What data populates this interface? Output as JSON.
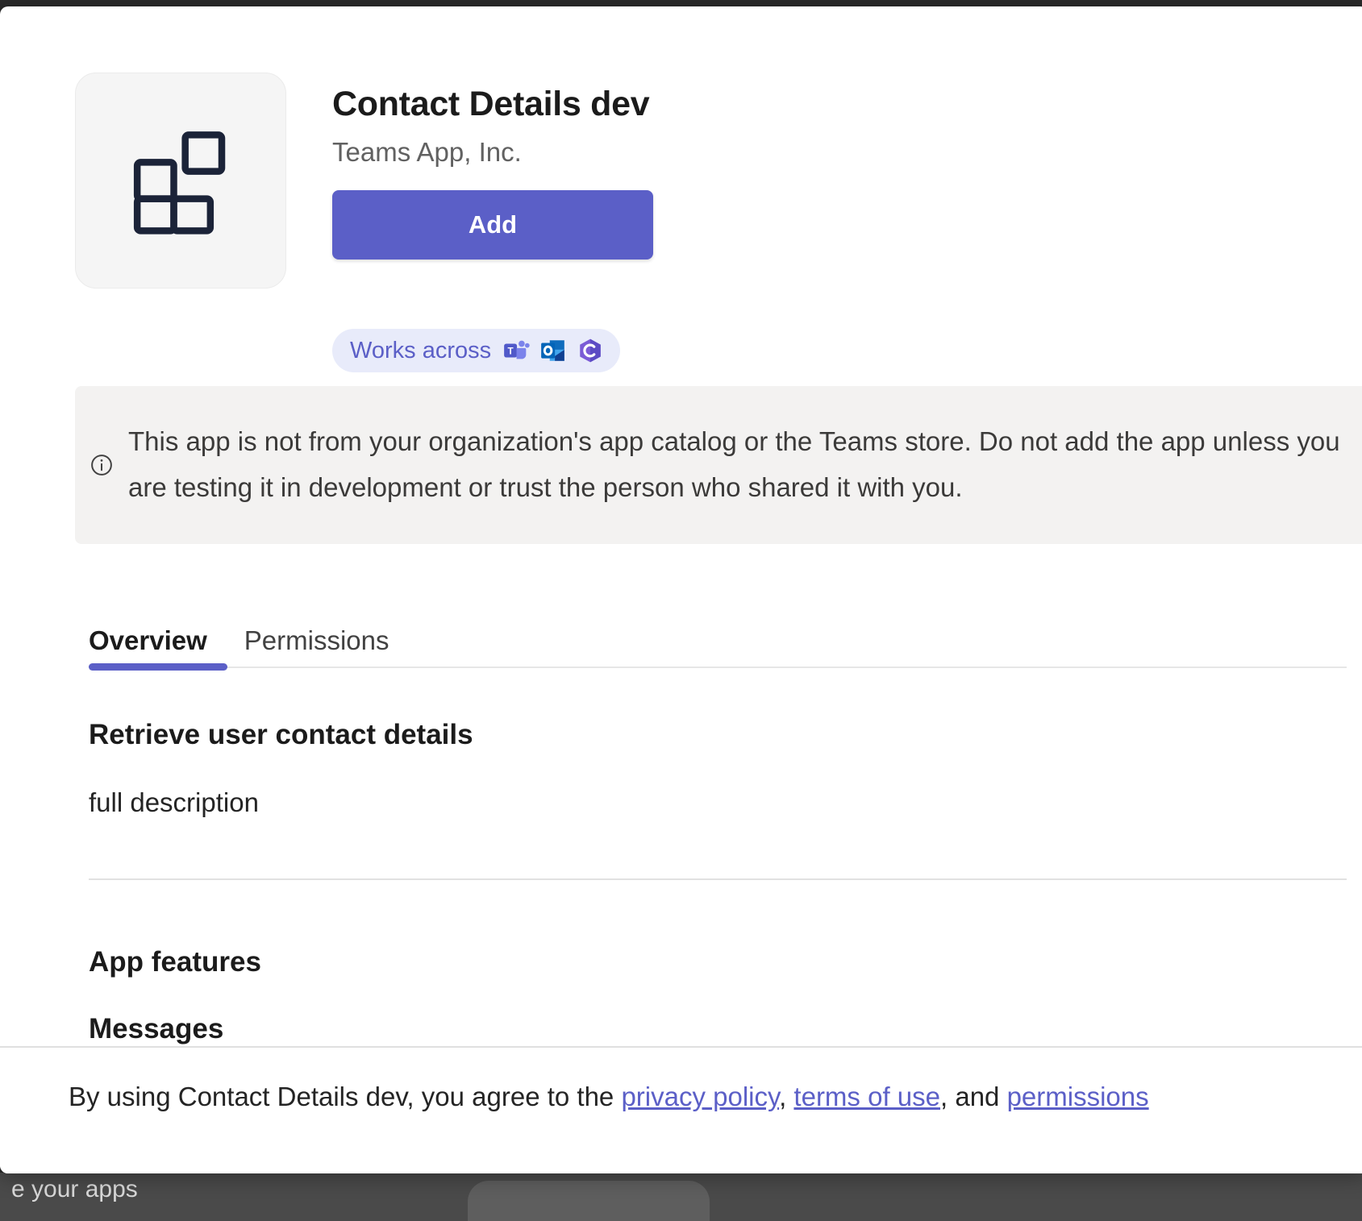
{
  "dialog": {
    "app_icon": "app-blocks-icon",
    "title": "Contact Details dev",
    "publisher": "Teams App, Inc.",
    "add_label": "Add",
    "accent_color": "#5b5fc7",
    "works_across": {
      "label": "Works across",
      "platforms": [
        {
          "name": "microsoft-teams-icon",
          "title": "Microsoft Teams"
        },
        {
          "name": "microsoft-outlook-icon",
          "title": "Microsoft Outlook"
        },
        {
          "name": "microsoft-365-copilot-icon",
          "title": "Microsoft 365 Copilot"
        }
      ]
    },
    "warning": {
      "icon": "info-circle-icon",
      "text": "This app is not from your organization's app catalog or the Teams store. Do not add the app unless you are testing it in development or trust the person who shared it with you.",
      "background": "#f3f2f1"
    },
    "tabs": [
      {
        "label": "Overview",
        "active": true
      },
      {
        "label": "Permissions",
        "active": false
      }
    ],
    "overview": {
      "heading": "Retrieve user contact details",
      "description": "full description"
    },
    "features": {
      "heading": "App features",
      "subheading": "Messages"
    },
    "footer": {
      "prefix": "By using Contact Details dev, you agree to the ",
      "link_privacy": "privacy policy",
      "separator_one": ", ",
      "link_terms": "terms of use",
      "separator_two": ", and ",
      "link_permissions": "permissions"
    }
  },
  "desktop": {
    "taskbar_label": "e your apps"
  }
}
